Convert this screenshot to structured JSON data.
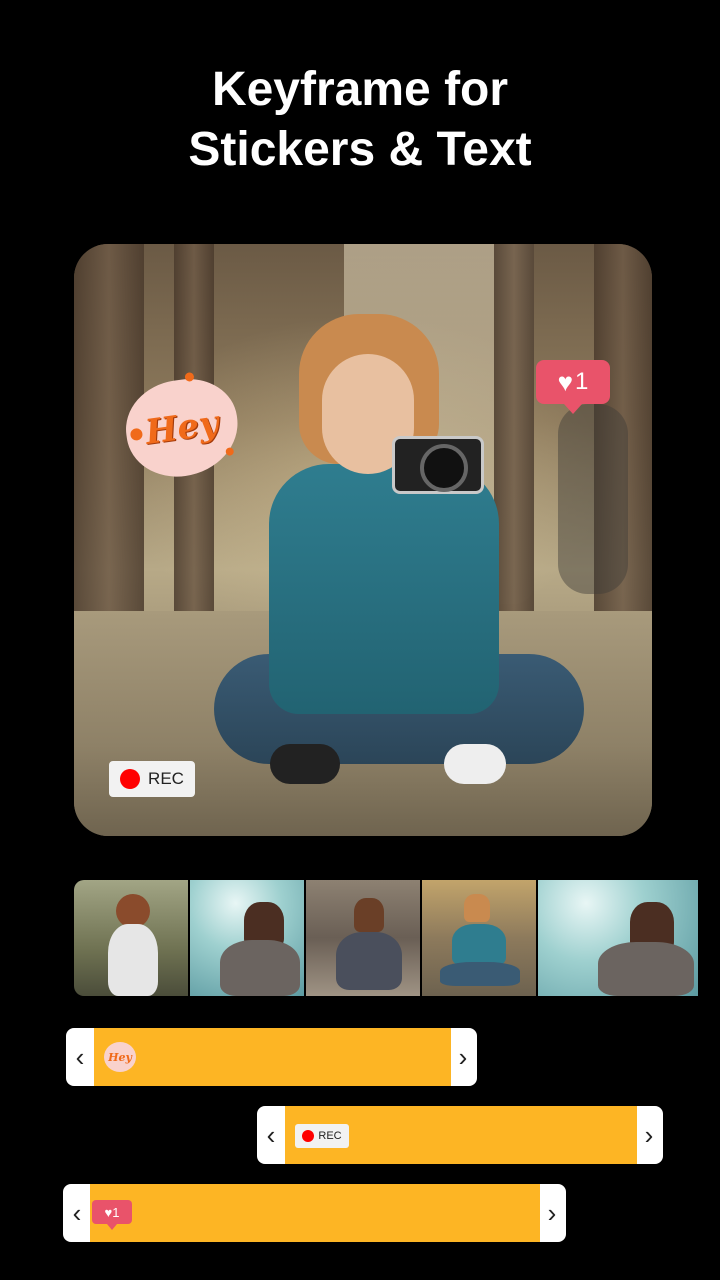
{
  "header": {
    "title_line1": "Keyframe for",
    "title_line2": "Stickers & Text"
  },
  "preview": {
    "sticker_hey": {
      "text": "Hey",
      "icon": "hey-sticker-icon"
    },
    "like_badge": {
      "count": "1",
      "icon": "heart-icon"
    },
    "rec_badge": {
      "label": "REC",
      "icon": "record-dot-icon"
    }
  },
  "filmstrip": {
    "frames": [
      "frame-1",
      "frame-2",
      "frame-3",
      "frame-4",
      "frame-5"
    ]
  },
  "tracks": [
    {
      "name": "hey-sticker-track",
      "prev_arrow": "‹",
      "next_arrow": "›",
      "thumb_text": "Hey"
    },
    {
      "name": "rec-track",
      "prev_arrow": "‹",
      "next_arrow": "›",
      "thumb_text": "REC"
    },
    {
      "name": "like-track",
      "prev_arrow": "‹",
      "next_arrow": "›",
      "thumb_text": "1"
    }
  ],
  "colors": {
    "background": "#000000",
    "track_fill": "#fdb524",
    "like_red": "#e9536a",
    "rec_red": "#ff0000"
  }
}
